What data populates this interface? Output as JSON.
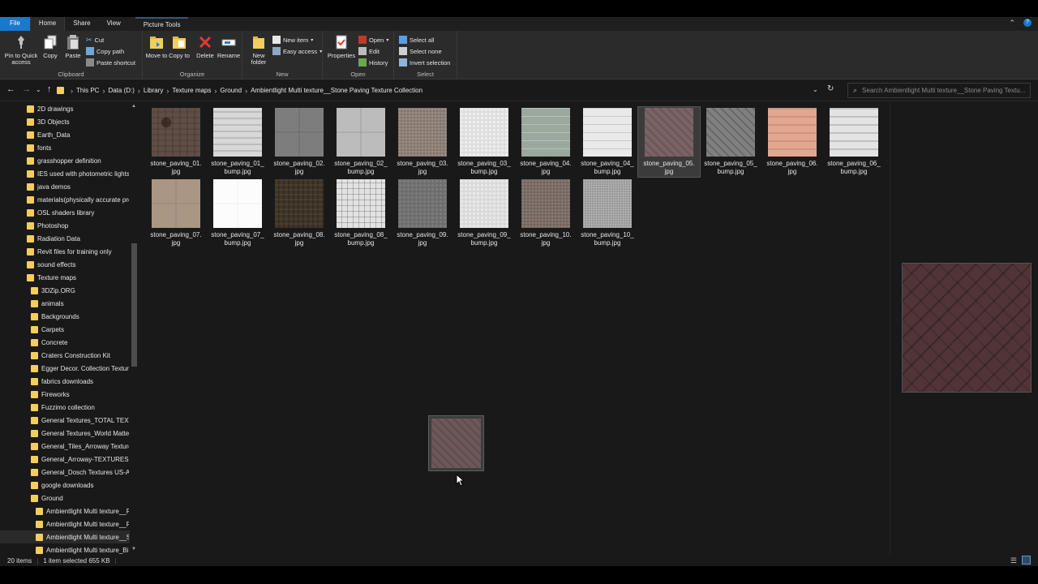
{
  "tabs": {
    "file": "File",
    "home": "Home",
    "share": "Share",
    "view": "View",
    "picture_tools": "Picture Tools"
  },
  "ribbon": {
    "clipboard": {
      "label": "Clipboard",
      "pin": "Pin to Quick access",
      "copy": "Copy",
      "paste": "Paste",
      "cut": "Cut",
      "copy_path": "Copy path",
      "paste_shortcut": "Paste shortcut"
    },
    "organize": {
      "label": "Organize",
      "move_to": "Move to",
      "copy_to": "Copy to",
      "delete": "Delete",
      "rename": "Rename"
    },
    "new": {
      "label": "New",
      "new_folder": "New folder",
      "new_item": "New item",
      "easy_access": "Easy access"
    },
    "open": {
      "label": "Open",
      "properties": "Properties",
      "open": "Open",
      "edit": "Edit",
      "history": "History"
    },
    "select": {
      "label": "Select",
      "select_all": "Select all",
      "select_none": "Select none",
      "invert": "Invert selection"
    }
  },
  "address": {
    "crumbs": [
      "This PC",
      "Data (D:)",
      "Library",
      "Texture maps",
      "Ground",
      "Ambientlight Multi texture__Stone Paving Texture Collection"
    ],
    "search_placeholder": "Search Ambientlight Multi texture__Stone Paving Textu..."
  },
  "sidebar": {
    "items": [
      "2D drawings",
      "3D Objects",
      "Earth_Data",
      "fonts",
      "grasshopper definition",
      "IES used with photometric lights",
      "java demos",
      "materials(physically accurate pre",
      "OSL shaders library",
      "Photoshop",
      "Radiation Data",
      "Revit files for training only",
      "sound effects",
      "Texture maps",
      "3DZip.ORG",
      "animals",
      "Backgrounds",
      "Carpets",
      "Concrete",
      "Craters Construction Kit",
      "Egger Decor. Collection Texture",
      "fabrics downloads",
      "Fireworks",
      "Fuzzimo collection",
      "General Textures_TOTAL TEXTUF",
      "General Textures_World Matter",
      "General_Tiles_Arroway Textures",
      "General_Arroway-TEXTURES-ED",
      "General_Dosch Textures US-Arc",
      "google downloads",
      "Ground",
      "Ambientlight Multi texture__F",
      "Ambientlight Multi texture__F",
      "Ambientlight Multi texture__S",
      "Ambientlight Multi texture_Bi"
    ]
  },
  "files": [
    {
      "l1": "stone_paving_01.",
      "l2": "jpg",
      "tx": "tx1"
    },
    {
      "l1": "stone_paving_01_",
      "l2": "bump.jpg",
      "tx": "tx2"
    },
    {
      "l1": "stone_paving_02.",
      "l2": "jpg",
      "tx": "tx3"
    },
    {
      "l1": "stone_paving_02_",
      "l2": "bump.jpg",
      "tx": "tx4"
    },
    {
      "l1": "stone_paving_03.",
      "l2": "jpg",
      "tx": "tx5"
    },
    {
      "l1": "stone_paving_03_",
      "l2": "bump.jpg",
      "tx": "tx6"
    },
    {
      "l1": "stone_paving_04.",
      "l2": "jpg",
      "tx": "tx7"
    },
    {
      "l1": "stone_paving_04_",
      "l2": "bump.jpg",
      "tx": "tx8"
    },
    {
      "l1": "stone_paving_05.",
      "l2": "jpg",
      "tx": "tx9",
      "selected": true
    },
    {
      "l1": "stone_paving_05_",
      "l2": "bump.jpg",
      "tx": "tx10"
    },
    {
      "l1": "stone_paving_06.",
      "l2": "jpg",
      "tx": "tx11"
    },
    {
      "l1": "stone_paving_06_",
      "l2": "bump.jpg",
      "tx": "tx12"
    },
    {
      "l1": "stone_paving_07.",
      "l2": "jpg",
      "tx": "tx13"
    },
    {
      "l1": "stone_paving_07_",
      "l2": "bump.jpg",
      "tx": "tx14"
    },
    {
      "l1": "stone_paving_08.",
      "l2": "jpg",
      "tx": "tx15"
    },
    {
      "l1": "stone_paving_08_",
      "l2": "bump.jpg",
      "tx": "tx16"
    },
    {
      "l1": "stone_paving_09.",
      "l2": "jpg",
      "tx": "tx17"
    },
    {
      "l1": "stone_paving_09_",
      "l2": "bump.jpg",
      "tx": "tx18"
    },
    {
      "l1": "stone_paving_10.",
      "l2": "jpg",
      "tx": "tx19"
    },
    {
      "l1": "stone_paving_10_",
      "l2": "bump.jpg",
      "tx": "tx20"
    }
  ],
  "status": {
    "count": "20 items",
    "selected": "1 item selected  655 KB"
  },
  "colors": {
    "file_tab": "#1979ca",
    "folder": "#f3cd5e",
    "background": "#191919"
  }
}
